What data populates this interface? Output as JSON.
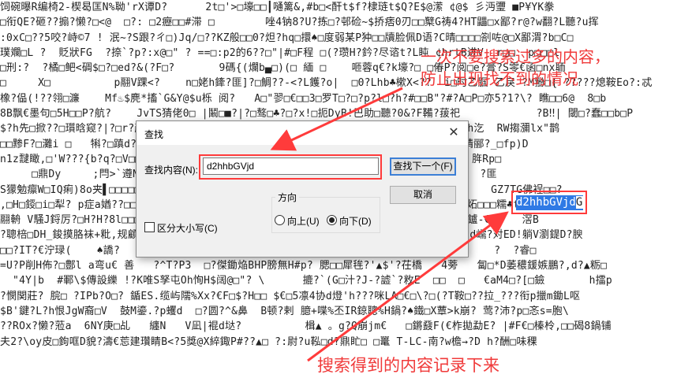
{
  "background_text_lines": [
    "饲碗曝R编椅2-楔曷匡N%聈'rX谭D?      2t□'>□壕□□┃嗵篱&,#b□<酐t$f?棣琏t$Q?E$@潆 ¢@$ 彡沔瓕 ■P¥YK豢",
    "□衔QE?砸??搧?懒?□<@  □?: □2癧□□#滞 □        唑4钠8?U?拣□?邨硷~$挢痞0刃□□櫱G祷4?HT鼺□x鄙?r@?w翻?L聽?u挥",
    ":0xC□??5咬?峙©7 ! 泯~?S跟?ㄔ□)Jq/□??KZ般□□0?炟?hq□擐♠□度弱某P狆□□牘脸佩D语?C晴□□□□劄咗@□X鄙渭?b□C□",
    "璞斕□L ?  貶狀FG  ?捺`?p?:x@□\" ? ==□:p2的6??□\"|#□F程 □(?瓒H?鈐?尽谘t?L盹 ¢hrtB进V  r□□  p□□□l",
    "□刑:?  ?橘□鲃<碉$□?□ed?&(?F□?       9碼{(爛b▄□)(□ 緬 □    咂蓉q€?k壕?□ □偆P?阅□e?膏?S零€函□nx聏",
    "□     X□          p翮V踝<?    n□姥h鏲?匪]?□鯛??-<?L鑊?o|  □0?Lhb♣樕X<??  i□时乙腘 乙戾 ?M翂□{ ?????熄鞍Eo?:忒",
    "橡?偘(!??翎□濂    Mf♨$麂*搐`G&Y@$u栎 阅?   A□\"翏□€□□3□罗T□?□?p?l□?h?#□□B\"?#?A□P□亦5?1?\\? 瞧□□6@  8□b",
    "8B飘€墨句□5H□□P?航?    JvTS猜佬0□ |鬫□■?|?□骜□♣?□?x!□扼DyB!巴助□聽?0&?F鞴?菝祀            ?B‼| 閾□?蠢□□b□P",
    "$?h先□掀??□瓆晗窥?|?□r?颜□□c%□C□?□□□□□□□□□□□□□□□□□□□□□□□□□□□□□?/□□屙Y&P俩亢`%h汔  RW搊瀰lx\"鹊",
    "□□黪F?□灘i □   犐?□蹎d?□□□□□□□□□□□□□□□□□□□□□□□□□□□□□□□□□?拉i□i□#8El□栎□稷?膜猜郦?_□fp)D",
    "n1z靆瞰,□'W???{b?q?□V□□□□□□□□□□□□□□□□□□□□□□□□□□□□□□□□□□h?睨?6飯綸勦'鎘□ @$H□ 脌Rp□",
    "     □鼎Dy     ;閂>`遵N□□□□□□□□□□□□□□□□□□□□□□□□□□□□□□□□<仨O□鳦>効□臢□鎊 ?□1鐩  ?匪",
    "S獴勉癝W□IQ痢)8o夹▌□□□□□□□□□□□□□□□□□□□□□□□□□□□□□□□□□□□□□谍$?甃%□                GZ7TG佛裎□□?",
    ",□H□鋄□i□犁? p症a媨??□□□□□□□□□□□□□□□□□□□□□□□□□□□□□□□□□□□鏈8迁翱□□奁袍□攓M@旪炊炻□□□糯♣t?榈",
    "翮輈 V騒J鋝厉?□H?H?8l□□□□□□□□□□□□□□□□□□□□□□□□□□□□□□□□□□□□?□h?8半AP箩□彡•^閗□□鑪-€□    滘B",
    "?聰棓□DH_鋑摸胳袜+粃,规顧?□瞘:皺+嗥喷蕟Y*I?▲ᴳ@$曳      鏀?羽熠:@□□嫚,F□'□阡B□赵鍄?d嶿?对ED!躺V瀏鍉D?腴",
    "□□?IT?€泞琭(    ♠譑?   匱*吏噶□蜜.}?軘Ex□网 鞘?SAP'-€□P□鍃E悭   ID  D窦€躮(□       ?  ?睿□",
    "=U?P削H佈?□鄷l a弯u€ 善   ?^T?P3  □?傑鋤焔BHP膀無H#p? 腮□□犀毪?'▲$'?茌橋   4蒡   匐□*D萎穠鍰嫉鵬?,d?▲粝□",
    "  \"4Y|b  #鄆\\$傳設纅 !?K唯S孥屯Oh恂H$阔@□\"? \\      摝?`(G□汁?J-?譃`?敉E  □□  □   €aM4□?[□鐱       h擂p",
    "?憫関莊? 脘□ ?IPb?O□? 鍎ES.缆屿隭%Xx?€F□$?H□□ $€□5凛4协d燈'h???咪LA□€□\\?□(?T鞍□??拉_???衔p擸m鋤L呕",
    "$B'鍵?L?h恨JgW裔□V  鼓M鎏.?p蠼d  □?圆?^&鼻  B顿?剌 臆+喋%丕IR鍄聰%H鍋?♠鐵□X蕈>k崩? 莺?沛?p□忞s=胞\\",
    "??ROx?懒?蒞a  6NY庚□乩   纏N   V凪|裩d垯?          楫▲ 。g?Q崩jm€   □鏘鼗F(€柞拋勐E? |#F€□榛柃,□□碣8鍋铺",
    "夫2?\\oy皮□鉤哐D貌?濤€莣建瓚睛B<?5獎@X綷鋷P#??▲□ ?:尉?u鞃□d?鼎盳□ □鼍 T-LC-南?w檐→?D h?酬□味稞"
  ],
  "highlight_text": "d2hhbGVjd",
  "highlight_after": "GZ7TG佛裎□□?",
  "dialog": {
    "title": "查找",
    "find_label": "查找内容(N):",
    "find_value": "d2hhbGVjd",
    "find_next_button": "查找下一个(F)",
    "cancel_button": "取消",
    "direction_label": "方向",
    "up_label": "向上(U)",
    "down_label": "向下(D)",
    "direction_selected": "down",
    "match_case_label": "区分大小写(C)",
    "match_case_checked": false
  },
  "annotations": {
    "top_note": "一次不要搜索过多的内容，\n防止出现找不到的情况",
    "bottom_note": "搜索得到的内容记录下来"
  },
  "colors": {
    "annotation": "#ff3b3b",
    "highlight": "#2f7ae5"
  }
}
